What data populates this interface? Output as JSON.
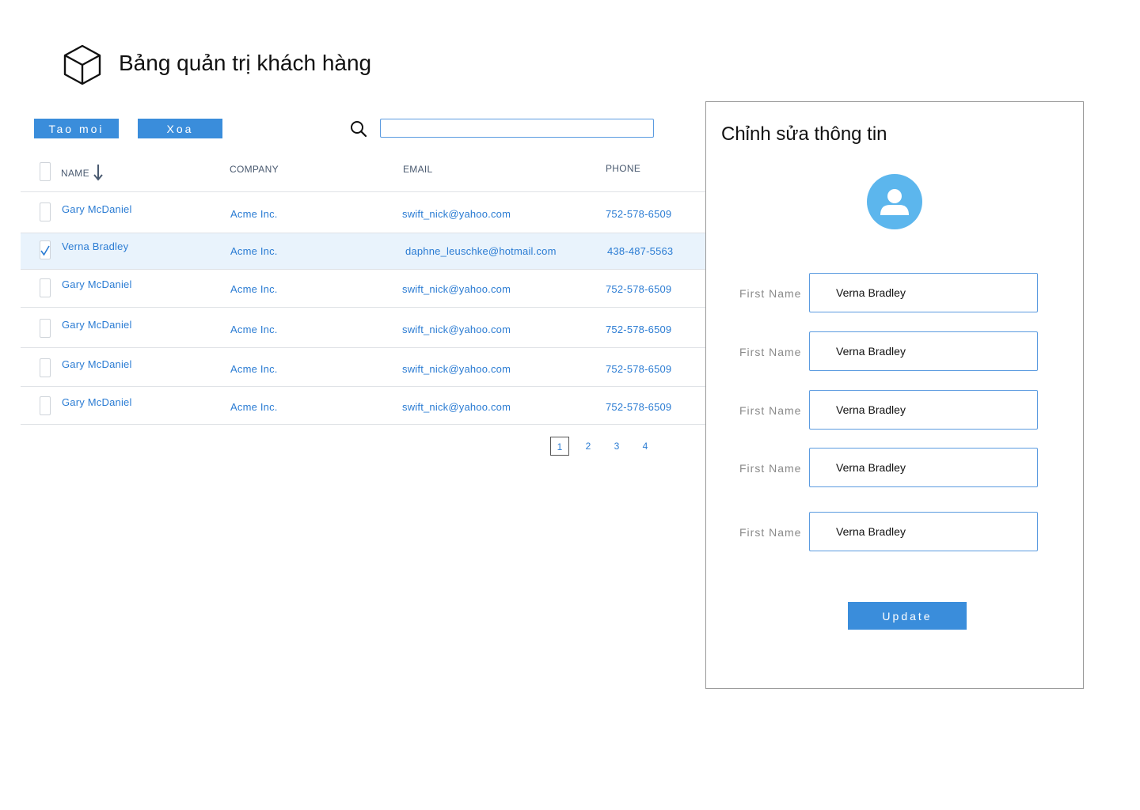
{
  "header": {
    "title": "Bảng quản trị khách hàng",
    "logo_icon": "cube-icon"
  },
  "toolbar": {
    "new_label": "Tao moi",
    "delete_label": "Xoa",
    "search_icon": "search-icon",
    "search_value": ""
  },
  "table": {
    "columns": {
      "name": "NAME",
      "company": "COMPANY",
      "email": "EMAIL",
      "phone": "PHONE"
    },
    "sort_icon": "arrow-down-icon",
    "rows": [
      {
        "name": "Gary McDaniel",
        "company": "Acme Inc.",
        "email": "swift_nick@yahoo.com",
        "phone": "752-578-6509",
        "checked": false
      },
      {
        "name": "Verna Bradley",
        "company": "Acme Inc.",
        "email": "daphne_leuschke@hotmail.com",
        "phone": "438-487-5563",
        "checked": true
      },
      {
        "name": "Gary McDaniel",
        "company": "Acme Inc.",
        "email": "swift_nick@yahoo.com",
        "phone": "752-578-6509",
        "checked": false
      },
      {
        "name": "Gary McDaniel",
        "company": "Acme Inc.",
        "email": "swift_nick@yahoo.com",
        "phone": "752-578-6509",
        "checked": false
      },
      {
        "name": "Gary McDaniel",
        "company": "Acme Inc.",
        "email": "swift_nick@yahoo.com",
        "phone": "752-578-6509",
        "checked": false
      },
      {
        "name": "Gary McDaniel",
        "company": "Acme Inc.",
        "email": "swift_nick@yahoo.com",
        "phone": "752-578-6509",
        "checked": false
      }
    ]
  },
  "pagination": {
    "pages": [
      "1",
      "2",
      "3",
      "4"
    ],
    "current": "1"
  },
  "edit_panel": {
    "title": "Chỉnh sửa thông tin",
    "avatar_icon": "user-icon",
    "fields": [
      {
        "label": "First Name",
        "value": "Verna Bradley"
      },
      {
        "label": "First Name",
        "value": "Verna Bradley"
      },
      {
        "label": "First Name",
        "value": "Verna Bradley"
      },
      {
        "label": "First Name",
        "value": "Verna Bradley"
      },
      {
        "label": "First Name",
        "value": "Verna Bradley"
      }
    ],
    "update_label": "Update"
  },
  "colors": {
    "accent": "#3a8ddb",
    "link": "#2b7cd3",
    "selected_row": "#e9f3fc",
    "avatar": "#5cb6ed"
  }
}
